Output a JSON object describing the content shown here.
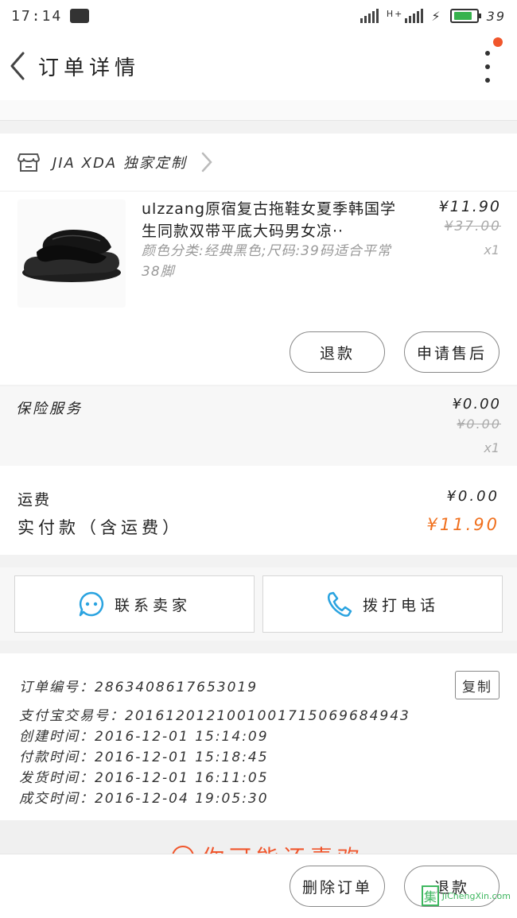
{
  "status_bar": {
    "time": "17:14",
    "network": "H+",
    "battery": "39",
    "battery_color": "#37b24d"
  },
  "nav": {
    "title": "订单详情",
    "back_icon": "chevron-left-icon",
    "more_icon": "more-vertical-icon",
    "badge_color": "#f0562c"
  },
  "shop": {
    "name": "JIA XDA 独家定制",
    "icon": "store-icon"
  },
  "product": {
    "title": "ulzzang原宿复古拖鞋女夏季韩国学生同款双带平底大码男女凉··",
    "spec": "颜色分类:经典黑色;尺码:39码适合平常38脚",
    "price": "¥11.90",
    "original_price": "¥37.00",
    "quantity": "x1",
    "buttons": {
      "refund": "退款",
      "after_sale": "申请售后"
    }
  },
  "insurance": {
    "label": "保险服务",
    "price": "¥0.00",
    "original_price": "¥0.00",
    "quantity": "x1"
  },
  "totals": {
    "freight_label": "运费",
    "freight_value": "¥0.00",
    "paid_label": "实付款（含运费）",
    "paid_value": "¥11.90",
    "paid_color": "#f0701e"
  },
  "contact": {
    "seller_label": "联系卖家",
    "call_label": "拨打电话",
    "accent": "#2aa3e0"
  },
  "order_info": {
    "order_no": "订单编号：2863408617653019",
    "alipay_no": "支付宝交易号：2016120121001001715069684943",
    "created": "创建时间：2016-12-01 15:14:09",
    "paid": "付款时间：2016-12-01 15:18:45",
    "shipped": "发货时间：2016-12-01 16:11:05",
    "completed": "成交时间：2016-12-04 19:05:30",
    "copy_label": "复制"
  },
  "recommend": {
    "text": "你可能还喜欢"
  },
  "bottom_bar": {
    "delete_label": "删除订单",
    "refund_label": "退款"
  },
  "watermark": {
    "text": "JiChengXin.com"
  }
}
